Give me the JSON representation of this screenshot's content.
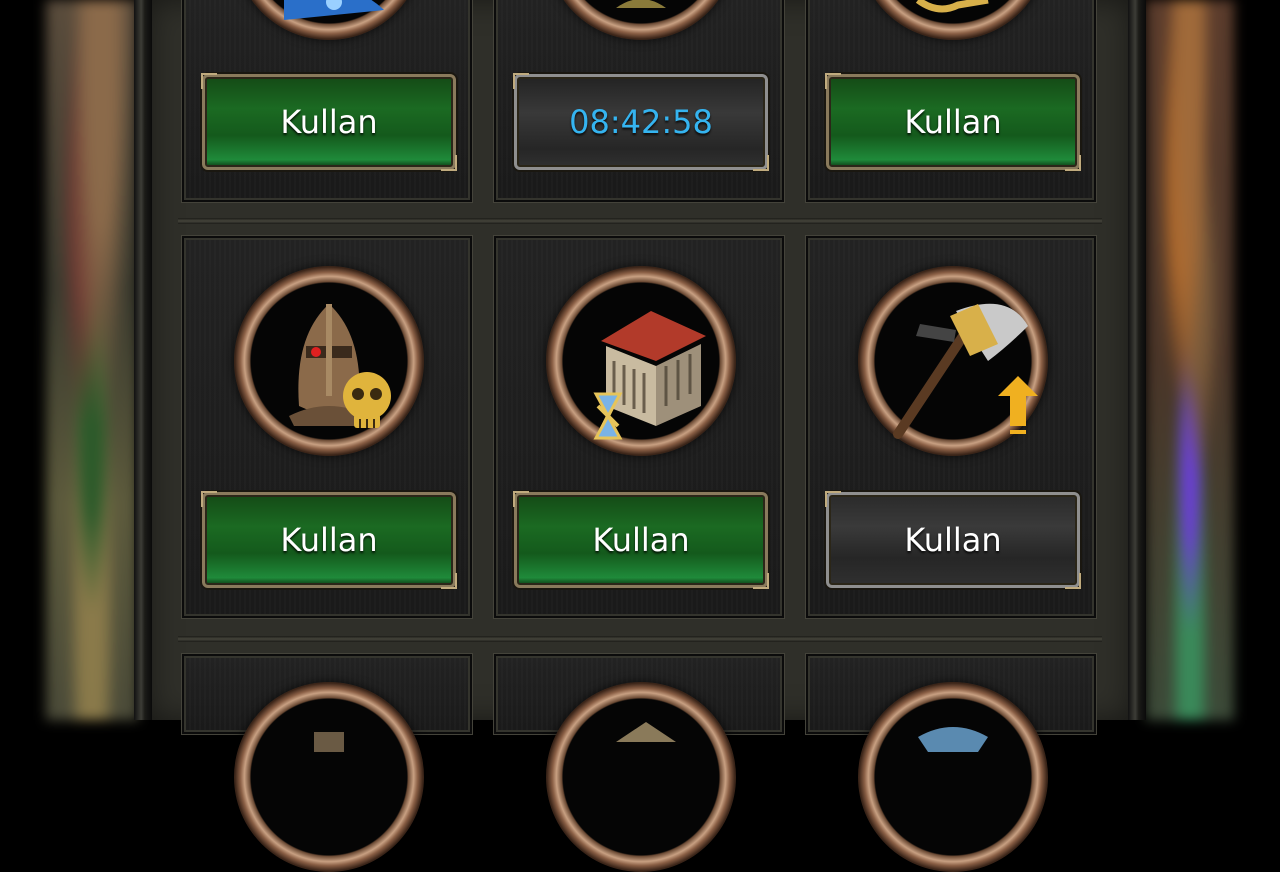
{
  "items": [
    {
      "row": 1,
      "col": 1,
      "icon": "blue-creature-icon",
      "button": {
        "label": "Kullan",
        "style": "green"
      }
    },
    {
      "row": 1,
      "col": 2,
      "icon": "item-icon",
      "button": {
        "label": "08:42:58",
        "style": "timer"
      }
    },
    {
      "row": 1,
      "col": 3,
      "icon": "gold-key-icon",
      "button": {
        "label": "Kullan",
        "style": "green"
      }
    },
    {
      "row": 2,
      "col": 1,
      "icon": "helmet-skull-icon",
      "button": {
        "label": "Kullan",
        "style": "green"
      }
    },
    {
      "row": 2,
      "col": 2,
      "icon": "building-hourglass-icon",
      "button": {
        "label": "Kullan",
        "style": "green"
      }
    },
    {
      "row": 2,
      "col": 3,
      "icon": "axe-upgrade-icon",
      "button": {
        "label": "Kullan",
        "style": "gray"
      }
    },
    {
      "row": 3,
      "col": 1,
      "icon": "item-icon"
    },
    {
      "row": 3,
      "col": 2,
      "icon": "item-icon"
    },
    {
      "row": 3,
      "col": 3,
      "icon": "item-icon"
    }
  ],
  "colors": {
    "button_green": "#1b6a22",
    "timer_text": "#35b4f0",
    "panel_bg": "#2f2f29"
  }
}
